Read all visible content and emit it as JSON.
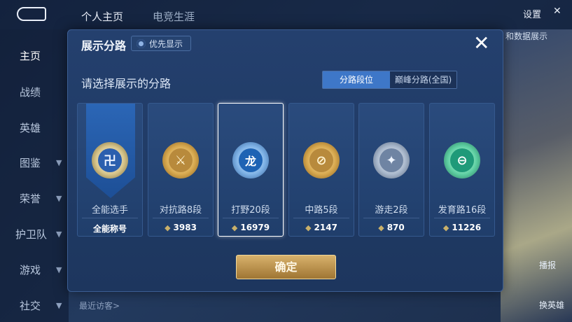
{
  "background": {
    "top_tabs": [
      "个人主页",
      "电竞生涯"
    ],
    "top_right": {
      "settings_label": "设置",
      "back_icon": "back-arrow-icon"
    },
    "sidebar_items": [
      {
        "label": "主页",
        "active": true
      },
      {
        "label": "战绩",
        "active": false
      },
      {
        "label": "英雄",
        "active": false
      },
      {
        "label": "图鉴",
        "active": false
      },
      {
        "label": "荣誉",
        "active": false
      },
      {
        "label": "护卫队",
        "active": false
      },
      {
        "label": "游戏",
        "active": false
      },
      {
        "label": "社交",
        "active": false
      }
    ],
    "footer_text": "最近访客>",
    "right_buttons": [
      "播报",
      "换英雄"
    ],
    "right_link": "和数据展示"
  },
  "modal": {
    "title": "展示分路",
    "priority_button": "优先显示",
    "subtitle": "请选择展示的分路",
    "tabs": [
      {
        "label": "分路段位",
        "active": true
      },
      {
        "label": "巅峰分路(全国)",
        "active": false
      }
    ],
    "cards": [
      {
        "lane": "全能选手",
        "value": "全能称号",
        "has_gem": false,
        "selected": false,
        "highlight_ribbon": true,
        "icon": "all-round-emblem-icon",
        "glyph": "卍"
      },
      {
        "lane": "对抗路8段",
        "value": "3983",
        "has_gem": true,
        "selected": false,
        "highlight_ribbon": false,
        "icon": "clash-lane-emblem-icon",
        "glyph": "⚔"
      },
      {
        "lane": "打野20段",
        "value": "16979",
        "has_gem": true,
        "selected": true,
        "highlight_ribbon": false,
        "icon": "jungle-emblem-icon",
        "glyph": "龙"
      },
      {
        "lane": "中路5段",
        "value": "2147",
        "has_gem": true,
        "selected": false,
        "highlight_ribbon": false,
        "icon": "mid-lane-emblem-icon",
        "glyph": "⊘"
      },
      {
        "lane": "游走2段",
        "value": "870",
        "has_gem": true,
        "selected": false,
        "highlight_ribbon": false,
        "icon": "roam-emblem-icon",
        "glyph": "✦"
      },
      {
        "lane": "发育路16段",
        "value": "11226",
        "has_gem": true,
        "selected": false,
        "highlight_ribbon": false,
        "icon": "farm-lane-emblem-icon",
        "glyph": "⊖"
      }
    ],
    "confirm_label": "确定"
  },
  "colors": {
    "modal_bg": "#1d365e",
    "tab_active": "#3e77c8",
    "confirm_gold": "#c9a25a"
  }
}
